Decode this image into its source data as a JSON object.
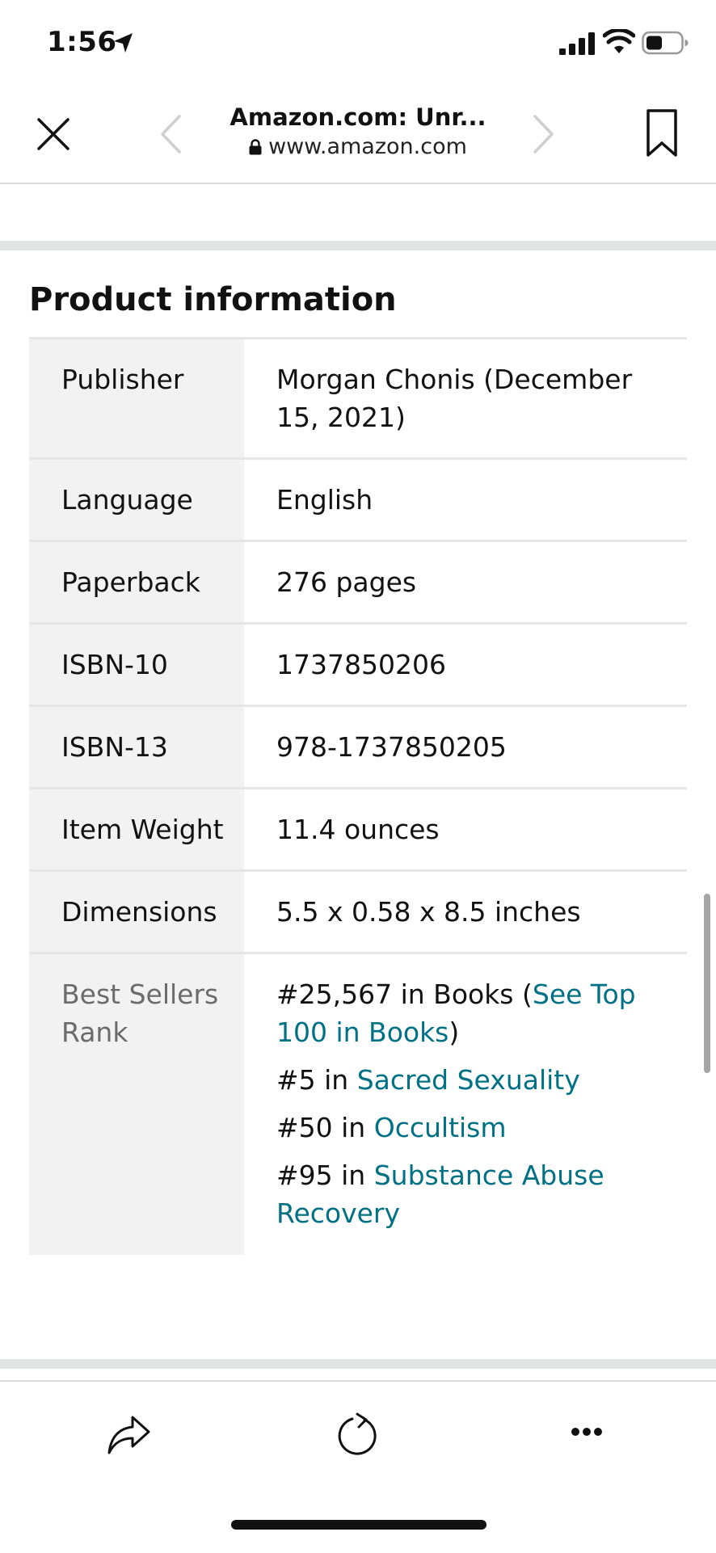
{
  "status_bar": {
    "time": "1:56",
    "icons": [
      "location-arrow-icon",
      "cellular-signal-icon",
      "wifi-icon",
      "battery-icon"
    ]
  },
  "browser": {
    "page_title": "Amazon.com: Unr...",
    "url": "www.amazon.com",
    "icons": [
      "close-icon",
      "back-chevron-icon",
      "forward-chevron-icon",
      "bookmark-icon",
      "lock-icon"
    ]
  },
  "section": {
    "title": "Product information"
  },
  "details": [
    {
      "key": "Publisher",
      "value": "Morgan Chonis (December 15, 2021)"
    },
    {
      "key": "Language",
      "value": "English"
    },
    {
      "key": "Paperback",
      "value": "276 pages"
    },
    {
      "key": "ISBN-10",
      "value": "1737850206"
    },
    {
      "key": "ISBN-13",
      "value": "978-1737850205"
    },
    {
      "key": "Item Weight",
      "value": "11.4 ounces"
    },
    {
      "key": "Dimensions",
      "value": "5.5 x 0.58 x 8.5 inches"
    }
  ],
  "best_sellers": {
    "key": "Best Sellers Rank",
    "ranks": [
      {
        "prefix": "#25,567 in Books (",
        "link": "See Top 100 in Books",
        "suffix": ")"
      },
      {
        "prefix": "#5 in ",
        "link": "Sacred Sexuality",
        "suffix": ""
      },
      {
        "prefix": "#50 in ",
        "link": "Occultism",
        "suffix": ""
      },
      {
        "prefix": "#95 in ",
        "link": "Substance Abuse Recovery",
        "suffix": ""
      }
    ]
  },
  "toolbar": {
    "icons": [
      "share-icon",
      "reload-icon",
      "more-icon"
    ]
  },
  "colors": {
    "link": "#007185",
    "key_background": "#f2f2f2",
    "divider_band": "#e3e6e6"
  }
}
